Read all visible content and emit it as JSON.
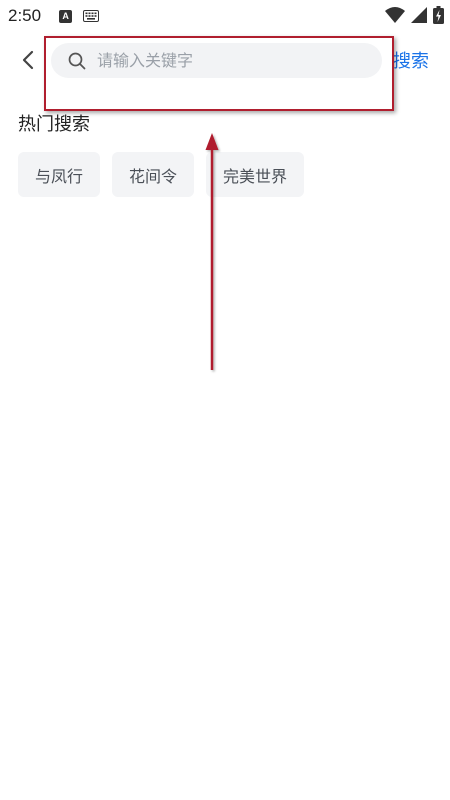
{
  "status_bar": {
    "time": "2:50",
    "a_icon_label": "A",
    "icons": [
      "keyboard-icon",
      "wifi-icon",
      "signal-icon",
      "battery-icon"
    ]
  },
  "header": {
    "search_placeholder": "请输入关键字",
    "search_value": "",
    "submit_label": "搜索"
  },
  "hot_search": {
    "title": "热门搜索",
    "tags": [
      "与凤行",
      "花间令",
      "完美世界"
    ]
  },
  "colors": {
    "accent": "#1a73e8",
    "annotation": "#b01e2e",
    "tag_bg": "#f3f4f6",
    "search_bg": "#f2f3f5"
  }
}
